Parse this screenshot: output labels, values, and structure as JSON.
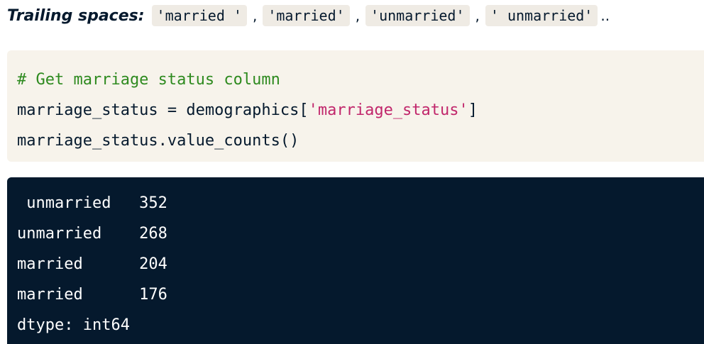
{
  "intro": {
    "label": "Trailing spaces:",
    "values": [
      "'married '",
      "'married'",
      "'unmarried'",
      "' unmarried'"
    ],
    "separator": ",",
    "ellipsis": ".."
  },
  "code": {
    "comment": "# Get marriage status column",
    "line2_prefix": "marriage_status = demographics[",
    "line2_string": "'marriage_status'",
    "line2_suffix": "]",
    "line3": "marriage_status.value_counts()"
  },
  "output": {
    "rows": [
      " unmarried   352",
      "unmarried    268",
      "married      204",
      "married      176"
    ],
    "dtype": "dtype: int64"
  },
  "colors": {
    "text": "#05192d",
    "chip_bg": "#efebe4",
    "code_bg": "#f7f3eb",
    "comment": "#2e8a1f",
    "string": "#c1266b",
    "output_bg": "#05192d",
    "output_text": "#ffffff"
  }
}
